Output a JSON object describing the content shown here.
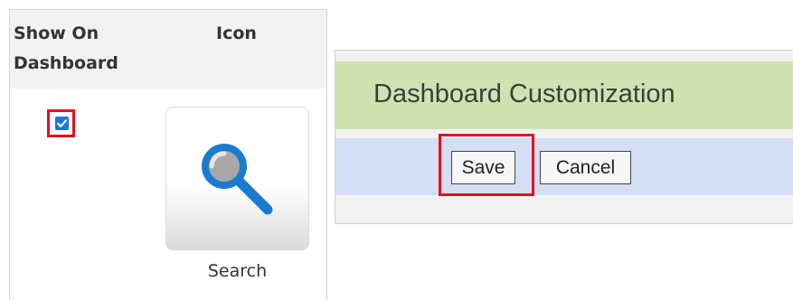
{
  "table": {
    "header_show_on_dashboard": "Show On Dashboard",
    "header_icon": "Icon",
    "row": {
      "show_on_dashboard_checked": true,
      "icon_name": "search-icon",
      "icon_label": "Search"
    }
  },
  "dialog": {
    "title": "Dashboard Customization",
    "save_label": "Save",
    "cancel_label": "Cancel"
  },
  "colors": {
    "highlight": "#e5101c",
    "title_bar": "#cfe3b2",
    "button_bar": "#d4dff5",
    "checkbox": "#1a73e8",
    "search_icon": "#1b7bd0"
  }
}
